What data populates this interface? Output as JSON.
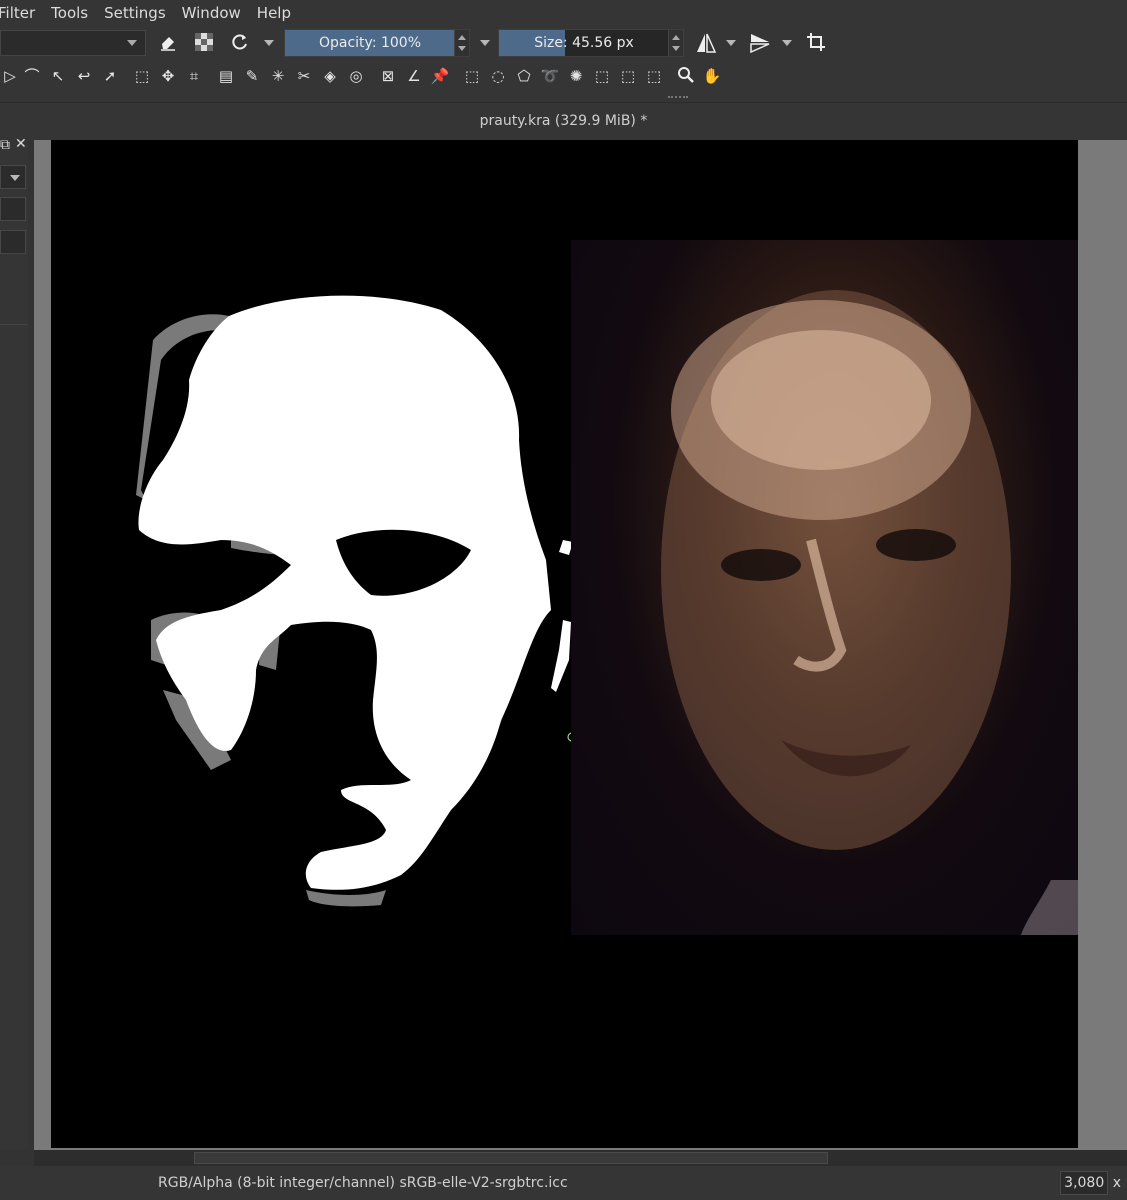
{
  "menu": [
    "Filter",
    "Tools",
    "Settings",
    "Window",
    "Help"
  ],
  "toolbar": {
    "opacity_label": "Opacity: 100%",
    "opacity_fraction": 1.0,
    "size_label": "Size: 45.56 px",
    "size_fill_fraction": 0.36
  },
  "document": {
    "title": "prauty.kra (329.9 MiB) *"
  },
  "status": {
    "color_info": "RGB/Alpha (8-bit integer/channel)  sRGB-elle-V2-srgbtrc.icc",
    "size_value": "3,080",
    "size_suffix": "x"
  },
  "colors": {
    "accent": "#4e6a8b",
    "canvas": "#000000",
    "panel": "#353535"
  },
  "icons": [
    "eraser-icon",
    "checker-icon",
    "refresh-icon",
    "mirror-horizontal-icon",
    "mirror-vertical-icon",
    "wrap-icon",
    "zoom-icon",
    "pan-icon"
  ]
}
